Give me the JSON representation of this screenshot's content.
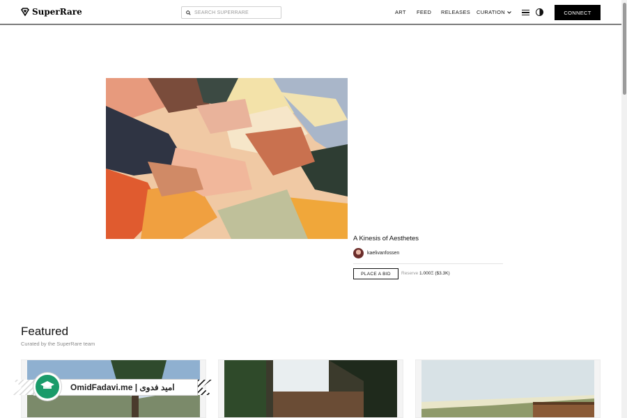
{
  "header": {
    "logo_text": "SuperRare",
    "search_placeholder": "SEARCH SUPERRARE",
    "nav": {
      "art": "ART",
      "feed": "FEED",
      "releases": "RELEASES",
      "curation": "CURATION"
    },
    "connect_label": "CONNECT"
  },
  "artwork": {
    "title": "A Kinesis of Aesthetes",
    "artist": "kaelivanfossen",
    "bid_label": "PLACE A BID",
    "reserve_label": "Reserve",
    "reserve_amount": "1.000Ξ ($3.3K)"
  },
  "featured": {
    "title": "Featured",
    "subtitle": "Curated by the SuperRare team"
  },
  "watermark": {
    "text": "OmidFadavi.me  |  امید فدوی"
  }
}
